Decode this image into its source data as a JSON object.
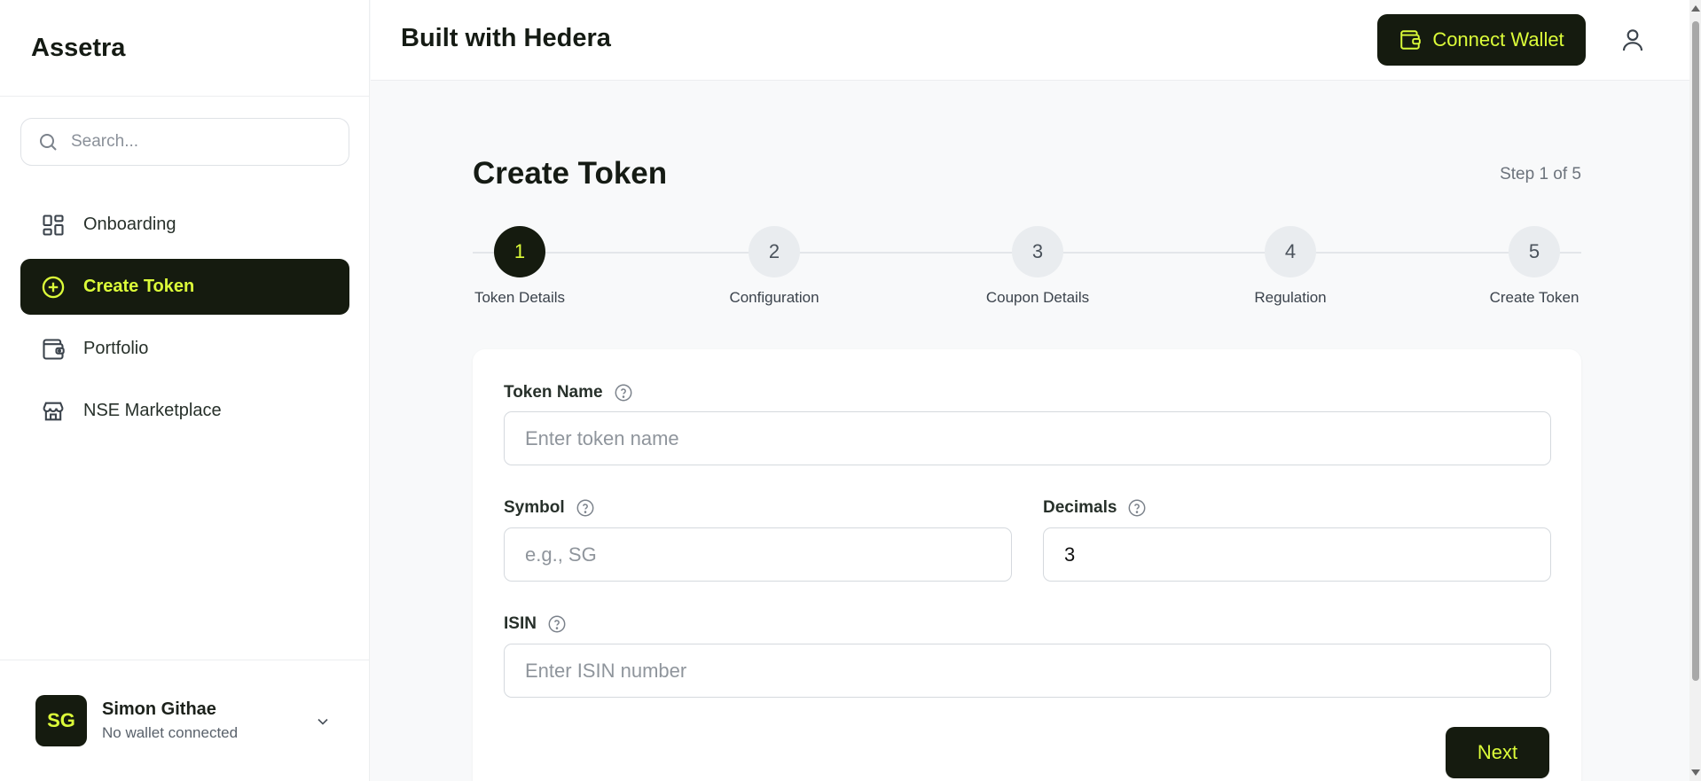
{
  "app": {
    "brand": "Assetra",
    "header_title": "Built with Hedera"
  },
  "search": {
    "placeholder": "Search..."
  },
  "sidebar": {
    "items": [
      {
        "label": "Onboarding",
        "icon": "dashboard-grid-icon",
        "active": false
      },
      {
        "label": "Create Token",
        "icon": "plus-circle-icon",
        "active": true
      },
      {
        "label": "Portfolio",
        "icon": "wallet-icon",
        "active": false
      },
      {
        "label": "NSE Marketplace",
        "icon": "store-icon",
        "active": false
      }
    ]
  },
  "user": {
    "initials": "SG",
    "name": "Simon Githae",
    "status": "No wallet connected"
  },
  "header": {
    "connect_wallet": "Connect Wallet"
  },
  "page": {
    "title": "Create Token",
    "step_indicator": "Step 1 of 5"
  },
  "stepper": {
    "steps": [
      {
        "number": "1",
        "label": "Token Details",
        "active": true
      },
      {
        "number": "2",
        "label": "Configuration",
        "active": false
      },
      {
        "number": "3",
        "label": "Coupon Details",
        "active": false
      },
      {
        "number": "4",
        "label": "Regulation",
        "active": false
      },
      {
        "number": "5",
        "label": "Create Token",
        "active": false
      }
    ]
  },
  "form": {
    "token_name": {
      "label": "Token Name",
      "placeholder": "Enter token name",
      "value": ""
    },
    "symbol": {
      "label": "Symbol",
      "placeholder": "e.g., SG",
      "value": ""
    },
    "decimals": {
      "label": "Decimals",
      "placeholder": "",
      "value": "3"
    },
    "isin": {
      "label": "ISIN",
      "placeholder": "Enter ISIN number",
      "value": ""
    },
    "next_label": "Next"
  },
  "colors": {
    "accent": "#dcfc39",
    "dark": "#151b0f"
  }
}
